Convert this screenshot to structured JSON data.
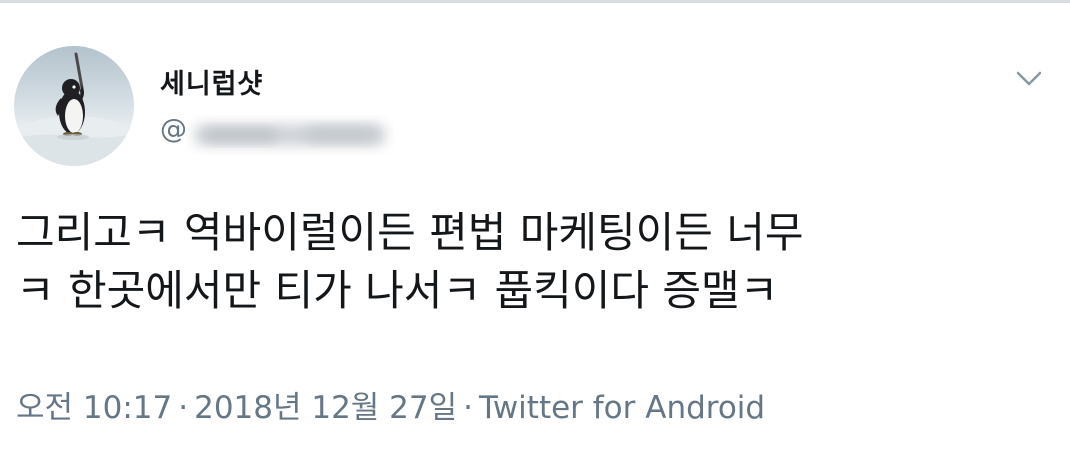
{
  "tweet": {
    "display_name": "세니럽샷",
    "handle": "@",
    "text_line_1": "그리고ㅋ 역바이럴이든 편법 마케팅이든 너무",
    "text_line_2": "ㅋ 한곳에서만 티가 나서ㅋ 풉킥이다 증맬ㅋ",
    "timestamp": "오전 10:17",
    "separator": "·",
    "date": "2018년 12월 27일",
    "source": "Twitter for Android"
  },
  "icons": {
    "caret": "chevron-down-icon",
    "avatar": "penguin-avatar"
  },
  "colors": {
    "text": "#14171a",
    "secondary": "#657786"
  }
}
